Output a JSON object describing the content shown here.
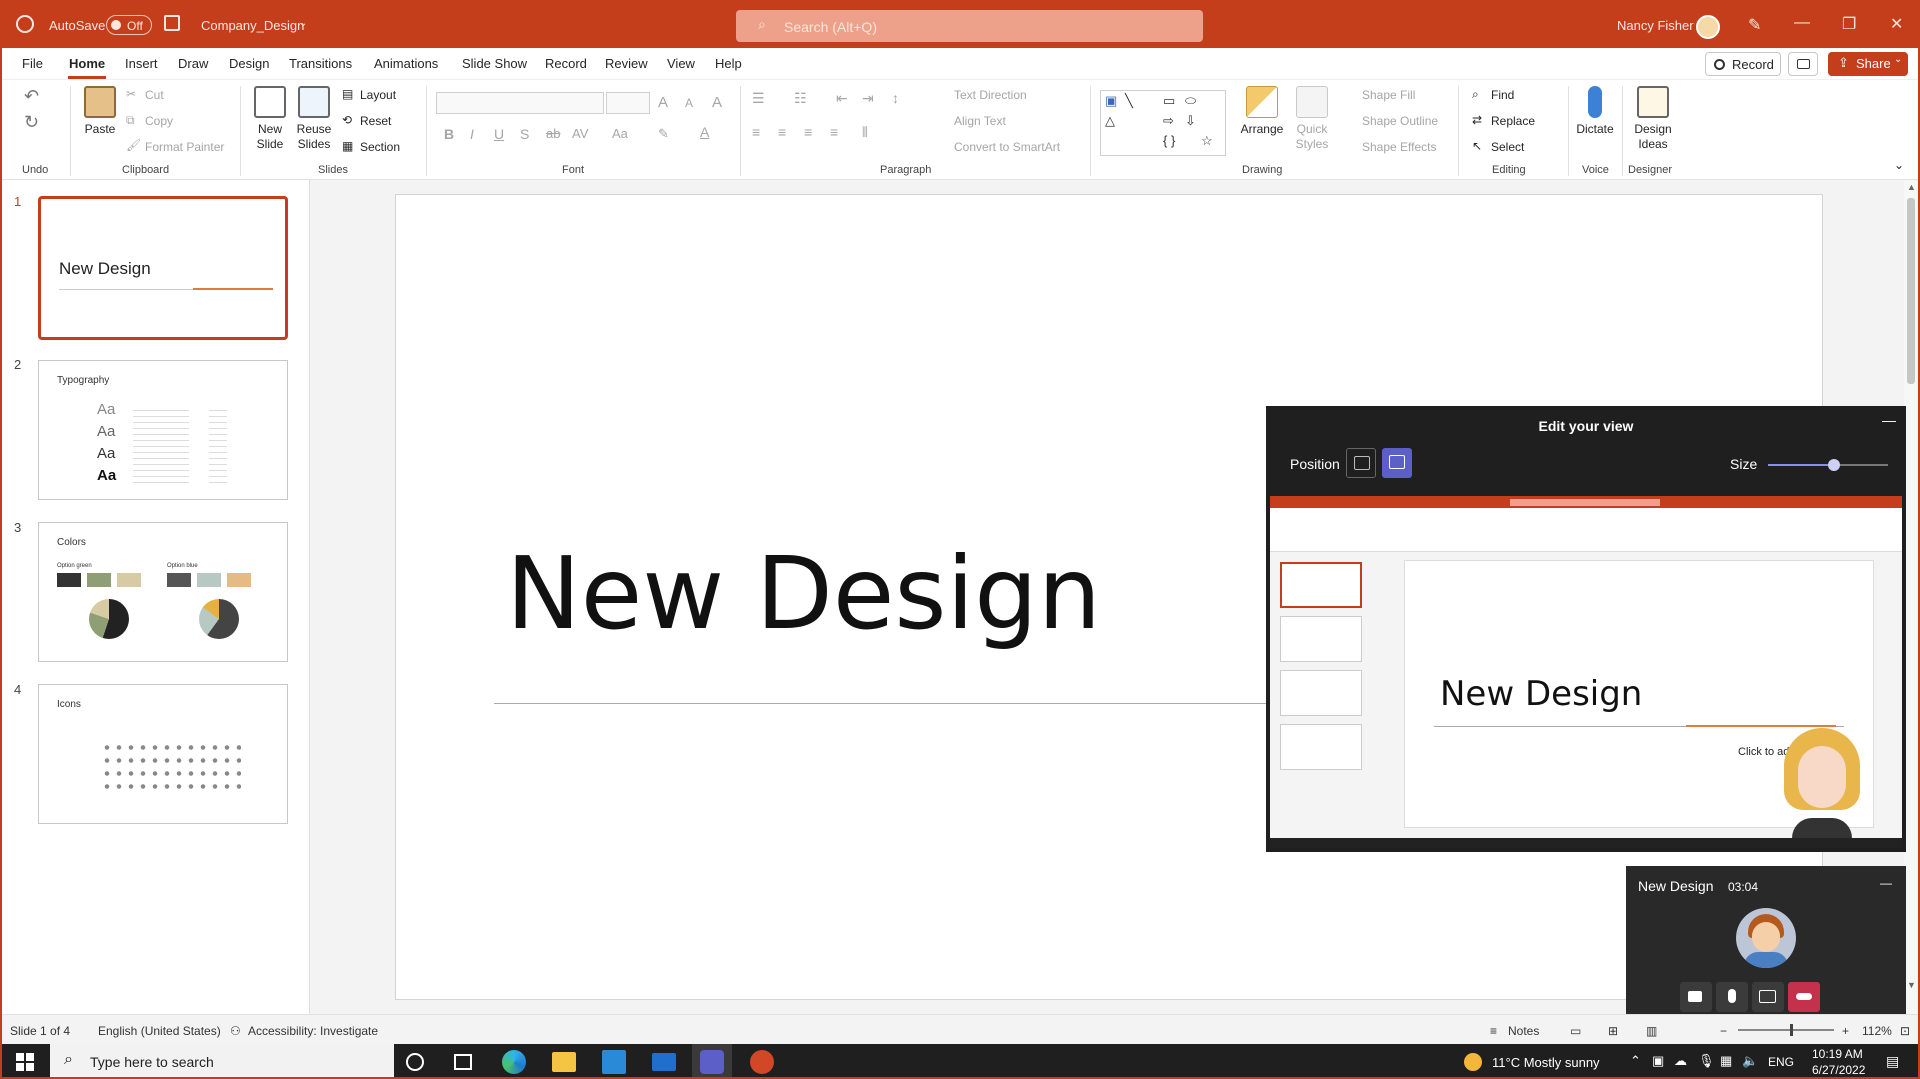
{
  "titlebar": {
    "autosave_label": "AutoSave",
    "autosave_state": "Off",
    "file_name": "Company_Design",
    "search_placeholder": "Search (Alt+Q)",
    "user_name": "Nancy Fisher",
    "brand_color": "#c43e1c"
  },
  "menu": {
    "tabs": [
      "File",
      "Home",
      "Insert",
      "Draw",
      "Design",
      "Transitions",
      "Animations",
      "Slide Show",
      "Record",
      "Review",
      "View",
      "Help"
    ],
    "active_tab": "Home",
    "record_label": "Record",
    "share_label": "Share"
  },
  "ribbon": {
    "undo": {
      "label": "Undo"
    },
    "clipboard": {
      "label": "Clipboard",
      "paste": "Paste",
      "cut": "Cut",
      "copy": "Copy",
      "format_painter": "Format Painter"
    },
    "slides": {
      "label": "Slides",
      "new_slide": "New",
      "new_slide2": "Slide",
      "reuse": "Reuse",
      "reuse2": "Slides",
      "layout": "Layout",
      "reset": "Reset",
      "section": "Section"
    },
    "font": {
      "label": "Font"
    },
    "paragraph": {
      "label": "Paragraph",
      "text_direction": "Text Direction",
      "align_text": "Align Text",
      "convert_smartart": "Convert to SmartArt"
    },
    "drawing": {
      "label": "Drawing",
      "arrange": "Arrange",
      "quick": "Quick",
      "styles": "Styles",
      "shape_fill": "Shape Fill",
      "shape_outline": "Shape Outline",
      "shape_effects": "Shape Effects"
    },
    "editing": {
      "label": "Editing",
      "find": "Find",
      "replace": "Replace",
      "select": "Select"
    },
    "voice": {
      "label": "Voice",
      "dictate": "Dictate"
    },
    "designer": {
      "label": "Designer",
      "design": "Design",
      "ideas": "Ideas"
    }
  },
  "thumbnails": [
    {
      "num": "1",
      "title": "New Design"
    },
    {
      "num": "2",
      "title": "Typography"
    },
    {
      "num": "3",
      "title": "Colors",
      "opt_a": "Option green",
      "opt_b": "Option blue"
    },
    {
      "num": "4",
      "title": "Icons"
    }
  ],
  "slide": {
    "title": "New Design"
  },
  "edit_view": {
    "title": "Edit your view",
    "position_label": "Position",
    "size_label": "Size",
    "size_level": 0.55,
    "preview_title": "New Design",
    "preview_click": "Click to ad"
  },
  "call": {
    "name": "New Design",
    "time": "03:04"
  },
  "statusbar": {
    "slide_info": "Slide 1 of 4",
    "language": "English (United States)",
    "accessibility": "Accessibility: Investigate",
    "notes": "Notes",
    "zoom": "112%"
  },
  "taskbar": {
    "search_placeholder": "Type here to search",
    "weather": "11°C  Mostly sunny",
    "lang": "ENG",
    "time": "10:19 AM",
    "date": "6/27/2022"
  }
}
